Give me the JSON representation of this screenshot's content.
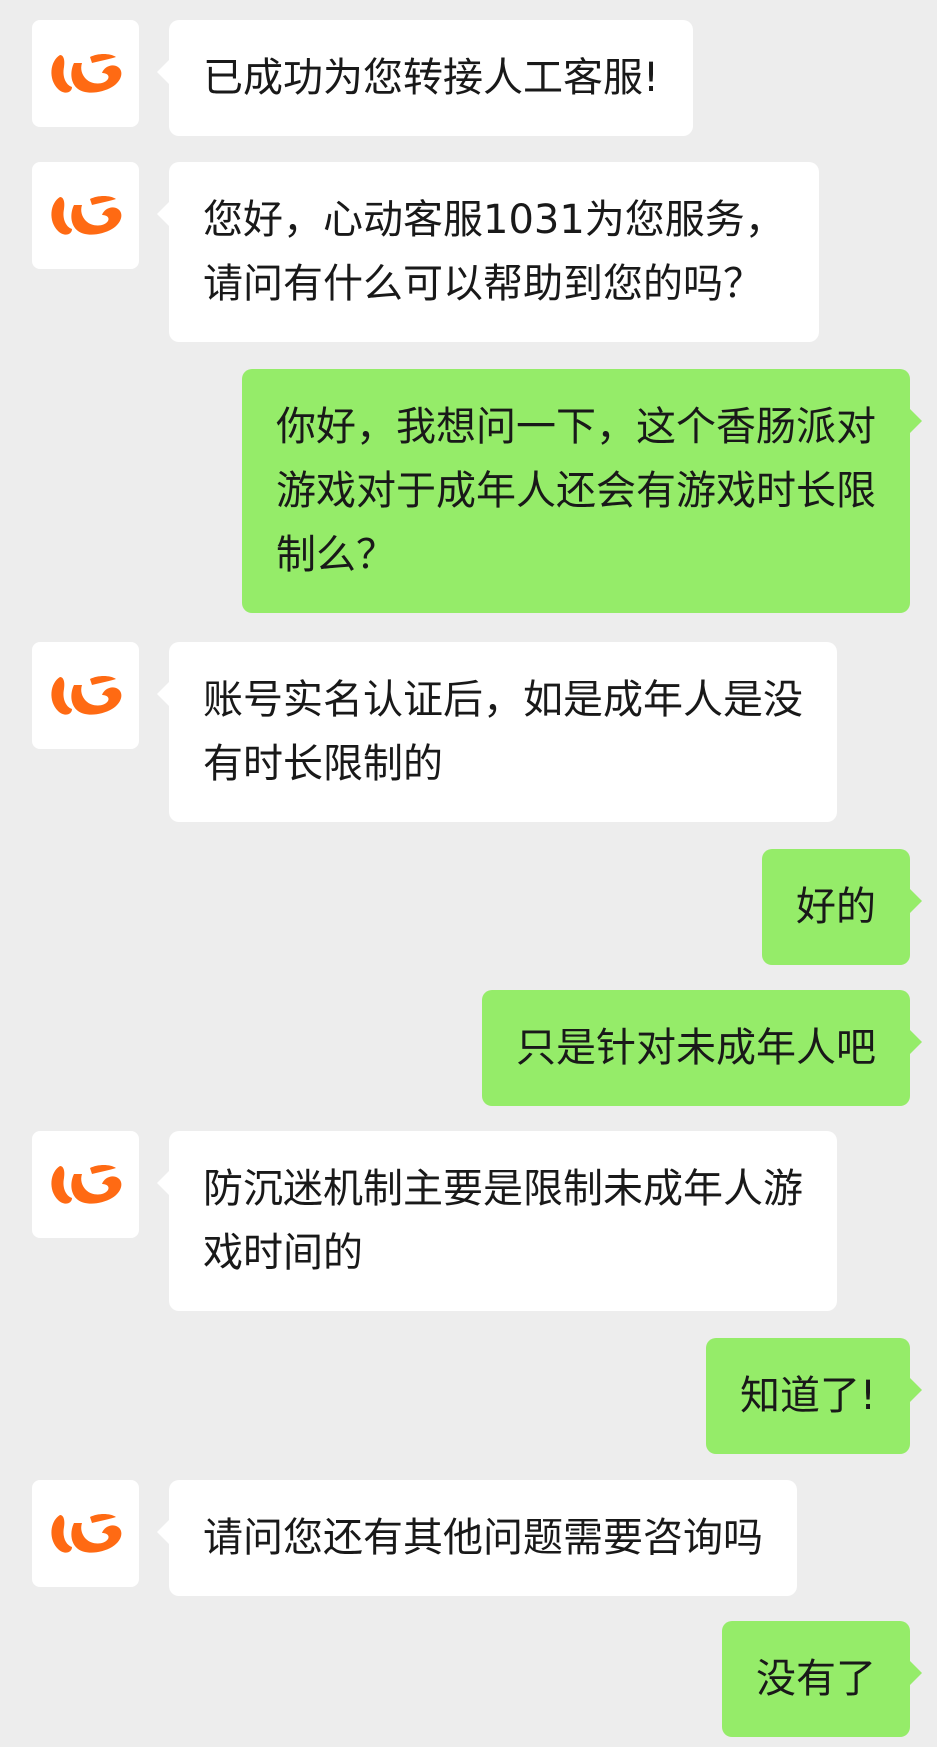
{
  "conversation": {
    "agent_avatar_icon": "orange-swirl-logo-icon",
    "accent_color": "#ff6a13",
    "incoming_bubble_color": "#ffffff",
    "outgoing_bubble_color": "#95ec69",
    "background_color": "#ededed",
    "messages": [
      {
        "from": "agent",
        "lines": [
          "已成功为您转接人工客服!"
        ]
      },
      {
        "from": "agent",
        "lines": [
          "您好，心动客服1031为您服务，",
          "请问有什么可以帮助到您的吗？"
        ]
      },
      {
        "from": "user",
        "lines": [
          "你好，我想问一下，这个香肠派对",
          "游戏对于成年人还会有游戏时长限",
          "制么？"
        ]
      },
      {
        "from": "agent",
        "lines": [
          "账号实名认证后，如是成年人是没",
          "有时长限制的"
        ]
      },
      {
        "from": "user",
        "lines": [
          "好的"
        ]
      },
      {
        "from": "user",
        "lines": [
          "只是针对未成年人吧"
        ]
      },
      {
        "from": "agent",
        "lines": [
          "防沉迷机制主要是限制未成年人游",
          "戏时间的"
        ]
      },
      {
        "from": "user",
        "lines": [
          "知道了!"
        ]
      },
      {
        "from": "agent",
        "lines": [
          "请问您还有其他问题需要咨询吗"
        ]
      },
      {
        "from": "user",
        "lines": [
          "没有了"
        ]
      }
    ]
  }
}
